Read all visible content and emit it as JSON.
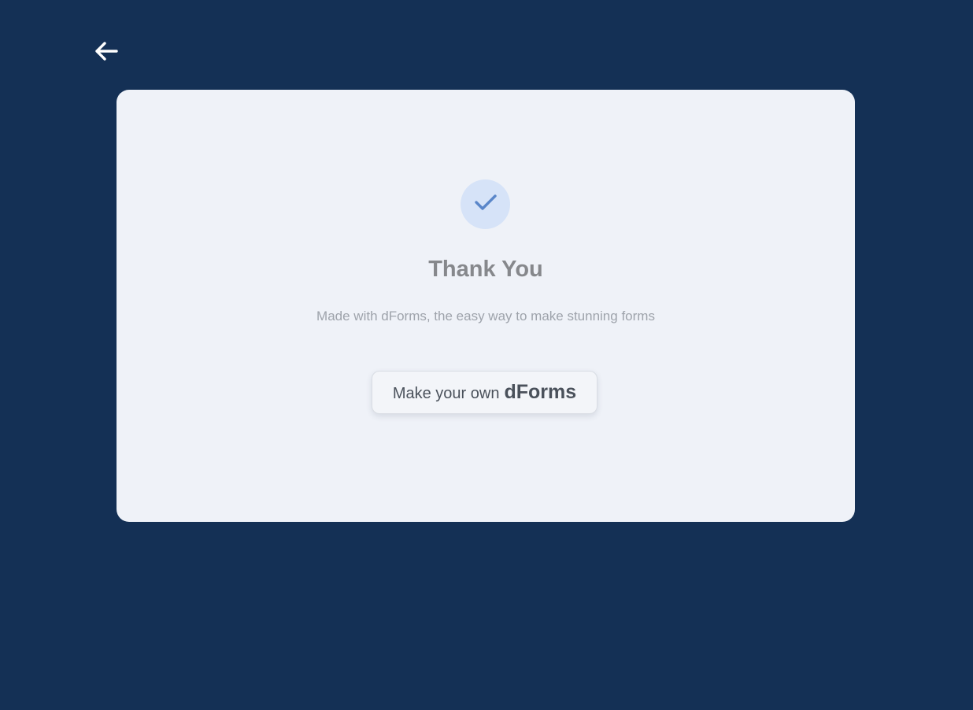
{
  "thank_you": {
    "title": "Thank You",
    "subtitle": "Made with dForms, the easy way to make stunning forms",
    "cta": {
      "prefix": "Make your own",
      "brand": "dForms"
    }
  },
  "icons": {
    "back": "arrow-left-icon",
    "success": "check-icon"
  },
  "colors": {
    "background": "#143055",
    "card": "#eff2f8",
    "check_badge": "#d6e3f8",
    "check_mark": "#5a86c9",
    "title_text": "#86888c",
    "subtitle_text": "#9ea3ab",
    "cta_text": "#4a515b"
  }
}
